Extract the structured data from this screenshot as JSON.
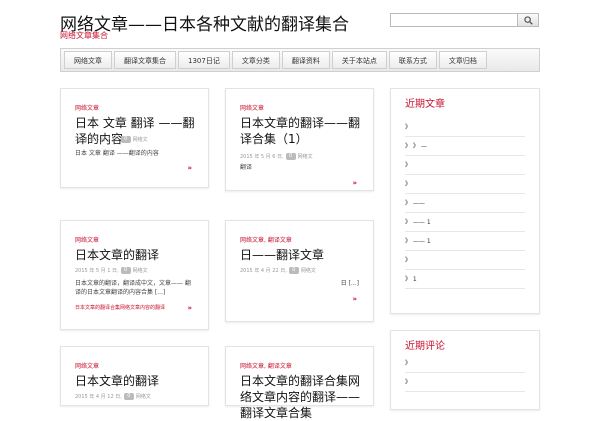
{
  "site": {
    "title": "网络文章——日本各种文献的翻译集合",
    "tagline": "网络文章集合",
    "search_placeholder": ""
  },
  "nav": [
    "网络文章",
    "翻译文章集合",
    "1307日记",
    "文章分类",
    "翻译资料",
    "关于本站点",
    "联系方式",
    "文章归档"
  ],
  "posts": [
    {
      "category": "网络文章",
      "title": "日本 文章 翻译 ——翻译的内容",
      "date": "2015 年 5 月 7 日,",
      "comments": "0",
      "author": "网络文",
      "excerpt": "日本 文章 翻译 ——翻译的内容",
      "more": "»"
    },
    {
      "category": "网络文章",
      "title": "日本文章的翻译——翻译合集（1）",
      "date": "2015 年 5 月 6 日,",
      "comments": "0",
      "author": "网络文",
      "excerpt": "翻译",
      "more": "»"
    },
    {
      "category": "网络文章",
      "title": "日本文章的翻译",
      "date": "2015 年 5 月 1 日,",
      "comments": "0",
      "author": "网络文",
      "excerpt": "日本文章的翻译，翻译成中文，文章——  翻译的日本文章翻译的内容合集 [...]",
      "link": "日本文章的翻译合集网络文章内容的翻译",
      "more": "»"
    },
    {
      "category": "网络文章, 翻译文章",
      "title": "日——翻译文章",
      "date": "2015 年 4 月 22 日,",
      "comments": "0",
      "author": "网络文",
      "excerpt": "日 [...]",
      "more": "»"
    },
    {
      "category": "网络文章",
      "title": "日本文章的翻译",
      "date": "2015 年 4 月 12 日,",
      "comments": "0",
      "author": "网络文"
    },
    {
      "category": "网络文章, 翻译文章",
      "title": "日本文章的翻译合集网络文章内容的翻译——翻译文章合集",
      "date": "",
      "comments": "",
      "author": ""
    }
  ],
  "sidebar": [
    {
      "title": "近期文章",
      "rows": [
        "》",
        "》  》  —",
        "》",
        "》",
        "》  ——",
        "》  ——  1",
        "》  ——  1",
        "》",
        "》  1"
      ]
    },
    {
      "title": "近期评论",
      "rows": [
        "》",
        "》"
      ]
    }
  ]
}
